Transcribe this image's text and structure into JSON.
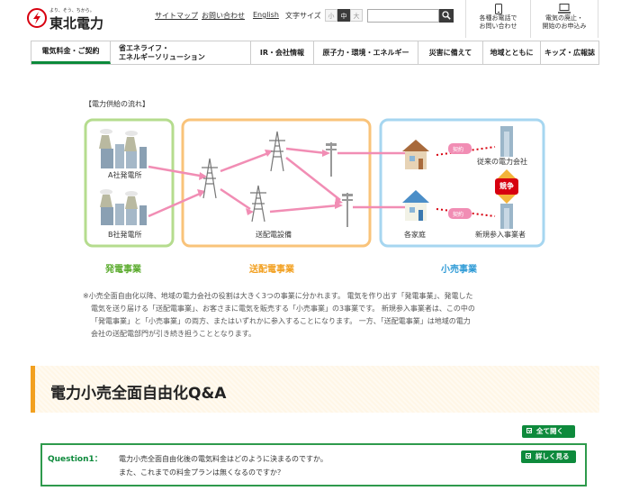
{
  "header": {
    "logo_tagline": "より、そう、ちから。",
    "logo_name": "東北電力",
    "util_links": [
      "サイトマップ",
      "お問い合わせ",
      "English"
    ],
    "font_size_label": "文字サイズ",
    "font_sizes": [
      "小",
      "中",
      "大"
    ],
    "search_placeholder": "",
    "contact_box": "各種お電話で\nお問い合わせ",
    "service_box": "電気の廃止・\n開始のお申込み"
  },
  "nav": {
    "items": [
      "電気料金・ご契約",
      "省エネライフ・\nエネルギーソリューション",
      "IR・会社情報",
      "原子力・環境・エネルギー",
      "災害に備えて",
      "地域とともに",
      "キッズ・広報誌"
    ]
  },
  "diagram": {
    "caption": "【電力供給の流れ】",
    "plant_a": "A社発電所",
    "plant_b": "B社発電所",
    "transmission": "送配電設備",
    "home": "各家庭",
    "existing_company": "従来の電力会社",
    "new_entrant": "新規参入事業者",
    "contract1": "契約",
    "contract2": "契約",
    "competition": "競争",
    "section_generation": "発電事業",
    "section_transmission": "送配電事業",
    "section_retail": "小売事業"
  },
  "note": {
    "lines": [
      "※小売全面自由化以降、地域の電力会社の役割は大きく3つの事業に分かれます。 電気を作り出す「発電事業」、発電した",
      "電気を送り届ける「送配電事業」、お客さまに電気を販売する「小売事業」の3事業です。 新規参入事業者は、この中の",
      "「発電事業」と「小売事業」の両方、またはいずれかに参入することになります。 一方、「送配電事業」は地域の電力",
      "会社の送配電部門が引き続き担うこととなります。"
    ]
  },
  "qa": {
    "title": "電力小売全面自由化Q&A",
    "open_all": "全て開く",
    "q1_label": "Question1：",
    "q1_line1": "電力小売全面自由化後の電気料金はどのように決まるのですか。",
    "q1_line2": "また、これまでの料金プランは無くなるのですか？",
    "more": "詳しく見る"
  },
  "colors": {
    "green": "#0e8a3c",
    "orange": "#f2a020",
    "red": "#d7000f",
    "gen_border": "#b5dc8e",
    "trans_border": "#f9c37a",
    "retail_border": "#a6d6f0",
    "pink_arrow": "#f18db4"
  }
}
